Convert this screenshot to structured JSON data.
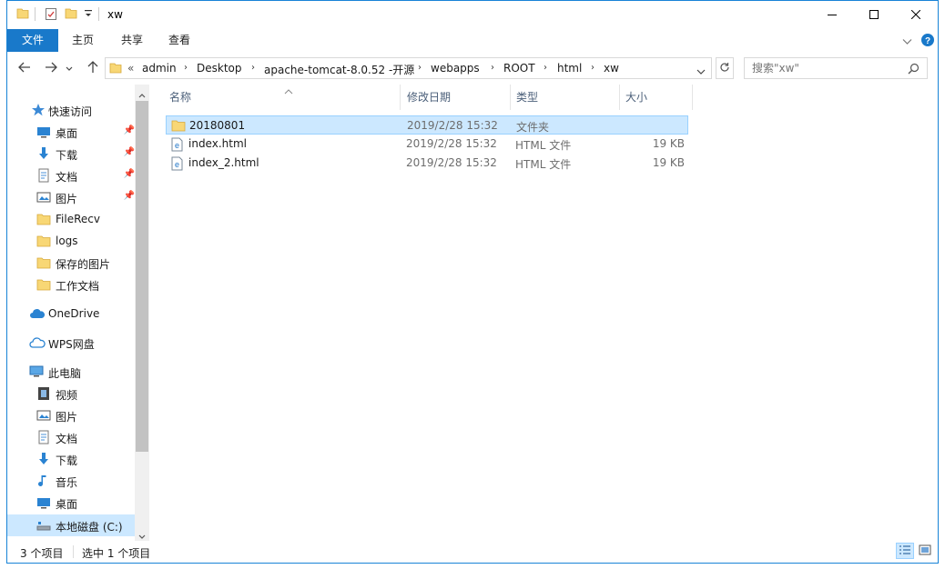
{
  "window": {
    "title": "xw",
    "accent": "#1979ca"
  },
  "quick_access_toolbar": {
    "icons": [
      "folder-icon",
      "properties-icon",
      "new-folder-icon",
      "customize-dropdown-icon"
    ]
  },
  "ribbon": {
    "tabs": [
      {
        "label": "文件"
      },
      {
        "label": "主页"
      },
      {
        "label": "共享"
      },
      {
        "label": "查看"
      }
    ]
  },
  "address_bar": {
    "overflow": "«",
    "crumbs": [
      "admin",
      "Desktop",
      "apache-tomcat-8.0.52 -开源",
      "webapps",
      "ROOT",
      "html",
      "xw"
    ]
  },
  "search": {
    "placeholder": "搜索\"xw\""
  },
  "sidebar": {
    "quick_access": {
      "label": "快速访问",
      "icon": "star-icon"
    },
    "quick_items": [
      {
        "label": "桌面",
        "icon": "desktop-icon",
        "pinned": true
      },
      {
        "label": "下载",
        "icon": "download-icon",
        "pinned": true
      },
      {
        "label": "文档",
        "icon": "documents-icon",
        "pinned": true
      },
      {
        "label": "图片",
        "icon": "pictures-icon",
        "pinned": true
      },
      {
        "label": "FileRecv",
        "icon": "folder-icon",
        "pinned": false
      },
      {
        "label": "logs",
        "icon": "folder-icon",
        "pinned": false
      },
      {
        "label": "保存的图片",
        "icon": "folder-icon",
        "pinned": false
      },
      {
        "label": "工作文档",
        "icon": "folder-icon",
        "pinned": false
      }
    ],
    "onedrive": {
      "label": "OneDrive",
      "icon": "cloud-icon"
    },
    "wps": {
      "label": "WPS网盘",
      "icon": "cloud-outline-icon"
    },
    "this_pc": {
      "label": "此电脑",
      "icon": "computer-icon"
    },
    "pc_items": [
      {
        "label": "视频",
        "icon": "video-icon"
      },
      {
        "label": "图片",
        "icon": "pictures-icon"
      },
      {
        "label": "文档",
        "icon": "documents-icon"
      },
      {
        "label": "下载",
        "icon": "download-icon"
      },
      {
        "label": "音乐",
        "icon": "music-icon"
      },
      {
        "label": "桌面",
        "icon": "desktop-icon"
      },
      {
        "label": "本地磁盘 (C:)",
        "icon": "drive-icon",
        "selected": true
      }
    ]
  },
  "file_list": {
    "columns": [
      "名称",
      "修改日期",
      "类型",
      "大小"
    ],
    "rows": [
      {
        "name": "20180801",
        "date": "2019/2/28 15:32",
        "type": "文件夹",
        "size": "",
        "icon": "folder-icon",
        "selected": true
      },
      {
        "name": "index.html",
        "date": "2019/2/28 15:32",
        "type": "HTML 文件",
        "size": "19 KB",
        "icon": "html-file-icon",
        "selected": false
      },
      {
        "name": "index_2.html",
        "date": "2019/2/28 15:32",
        "type": "HTML 文件",
        "size": "19 KB",
        "icon": "html-file-icon",
        "selected": false
      }
    ]
  },
  "status_bar": {
    "item_count": "3 个项目",
    "selection": "选中 1 个项目"
  }
}
